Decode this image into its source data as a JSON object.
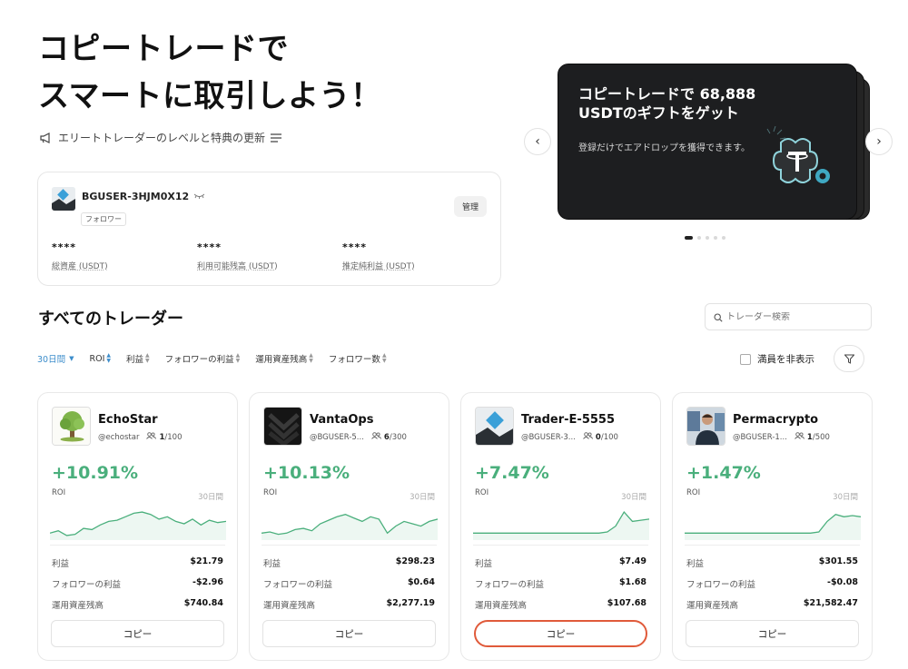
{
  "hero": {
    "line1": "コピートレードで",
    "line2": "スマートに取引しよう！"
  },
  "update_text": "エリートトレーダーのレベルと特典の更新",
  "account": {
    "name": "BGUSER-3HJM0X12",
    "badge": "フォロワー",
    "manage_label": "管理",
    "stats": [
      {
        "value": "****",
        "label": "総資産 (USDT)"
      },
      {
        "value": "****",
        "label": "利用可能残高 (USDT)"
      },
      {
        "value": "****",
        "label": "推定純利益 (USDT)"
      }
    ]
  },
  "banner": {
    "title": "コピートレードで 68,888 USDTのギフトをゲット",
    "subtitle": "登録だけでエアドロップを獲得できます。",
    "prev_icon": "‹",
    "next_icon": "›"
  },
  "section_title": "すべてのトレーダー",
  "search": {
    "placeholder": "トレーダー検索"
  },
  "filters": {
    "period": "30日間",
    "items": [
      "ROI",
      "利益",
      "フォロワーの利益",
      "運用資産残高",
      "フォロワー数"
    ]
  },
  "hide_full_label": "満員を非表示",
  "traders": [
    {
      "name": "EchoStar",
      "handle": "@echostar",
      "count": "1",
      "capacity": "/100",
      "roi": "+10.91%",
      "roi_label": "ROI",
      "period": "30日間",
      "profit_label": "利益",
      "profit": "$21.79",
      "follower_profit_label": "フォロワーの利益",
      "follower_profit": "-$2.96",
      "aum_label": "運用資産残高",
      "aum": "$740.84",
      "copy_label": "コピー",
      "spark": [
        30,
        32,
        28,
        29,
        34,
        33,
        37,
        40,
        41,
        44,
        47,
        48,
        46,
        42,
        44,
        40,
        38,
        42,
        37,
        41,
        39,
        40
      ]
    },
    {
      "name": "VantaOps",
      "handle": "@BGUSER-5...",
      "count": "6",
      "capacity": "/300",
      "roi": "+10.13%",
      "roi_label": "ROI",
      "period": "30日間",
      "profit_label": "利益",
      "profit": "$298.23",
      "follower_profit_label": "フォロワーの利益",
      "follower_profit": "$0.64",
      "aum_label": "運用資産残高",
      "aum": "$2,277.19",
      "copy_label": "コピー",
      "spark": [
        30,
        31,
        29,
        30,
        33,
        34,
        32,
        38,
        41,
        44,
        46,
        43,
        40,
        44,
        42,
        30,
        36,
        40,
        38,
        36,
        40,
        42
      ]
    },
    {
      "name": "Trader-E-5555",
      "handle": "@BGUSER-3...",
      "count": "0",
      "capacity": "/100",
      "roi": "+7.47%",
      "roi_label": "ROI",
      "period": "30日間",
      "profit_label": "利益",
      "profit": "$7.49",
      "follower_profit_label": "フォロワーの利益",
      "follower_profit": "$1.68",
      "aum_label": "運用資産残高",
      "aum": "$107.68",
      "copy_label": "コピー",
      "spark": [
        30,
        30,
        30,
        30,
        30,
        30,
        30,
        30,
        30,
        30,
        30,
        30,
        30,
        30,
        30,
        30,
        31,
        36,
        48,
        40,
        41,
        42
      ]
    },
    {
      "name": "Permacrypto",
      "handle": "@BGUSER-1...",
      "count": "1",
      "capacity": "/500",
      "roi": "+1.47%",
      "roi_label": "ROI",
      "period": "30日間",
      "profit_label": "利益",
      "profit": "$301.55",
      "follower_profit_label": "フォロワーの利益",
      "follower_profit": "-$0.08",
      "aum_label": "運用資産残高",
      "aum": "$21,582.47",
      "copy_label": "コピー",
      "spark": [
        30,
        30,
        30,
        30,
        30,
        30,
        30,
        30,
        30,
        30,
        30,
        30,
        30,
        30,
        30,
        30,
        31,
        40,
        46,
        44,
        45,
        44
      ]
    }
  ],
  "colors": {
    "roi_green": "#4aaf7c",
    "link_blue": "#3c8dcb",
    "highlight_red": "#e05a3a"
  }
}
